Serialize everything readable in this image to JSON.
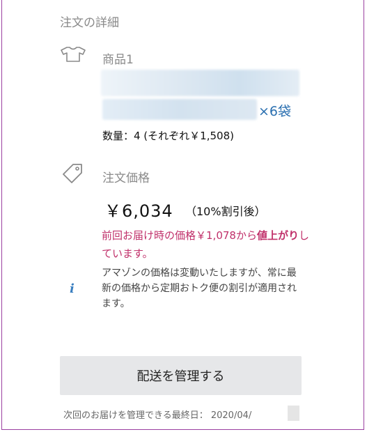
{
  "section": {
    "title": "注文の詳細"
  },
  "product": {
    "label": "商品1",
    "name_suffix": "×6袋",
    "quantity_text": "数量：4 (それぞれ￥1,508)"
  },
  "price": {
    "label": "注文価格",
    "amount": "￥6,034",
    "discount_note": "（10%割引後）",
    "warning_part1": "前回お届け時の価格￥1,078から",
    "warning_bold": "値上がり",
    "warning_part2": "しています。",
    "info_icon": "i",
    "note": "アマゾンの価格は変動いたしますが、常に最新の価格から定期おトク便の割引が適用されます。"
  },
  "actions": {
    "manage_label": "配送を管理する"
  },
  "deadline": {
    "text": "次回のお届けを管理できる最終日： 2020/04/"
  },
  "colors": {
    "accent_pink": "#c0306a",
    "link_blue": "#2a6fb0",
    "gray": "#8a8a8a",
    "border_purple": "#9b3fa0"
  }
}
